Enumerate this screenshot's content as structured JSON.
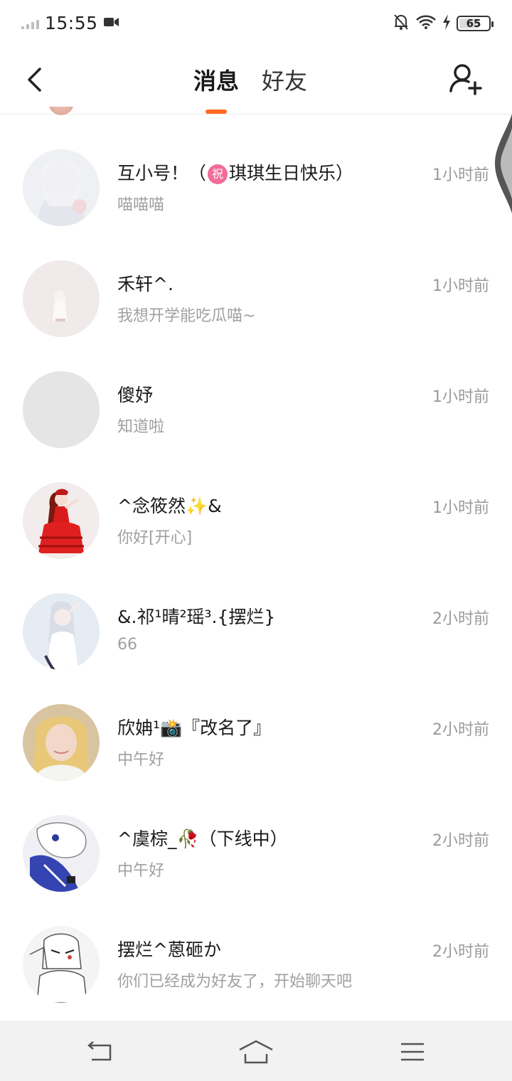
{
  "status_bar": {
    "time": "15:55",
    "battery_level": "65",
    "icons": [
      "signal-icon",
      "video-icon",
      "mute-icon",
      "wifi-icon",
      "charging-icon",
      "battery-icon"
    ]
  },
  "header": {
    "tabs": [
      {
        "label": "消息",
        "active": true
      },
      {
        "label": "好友",
        "active": false
      }
    ],
    "accent_color": "#ff6a1f"
  },
  "conversations": [
    {
      "name_pre": "互小号！（",
      "badge": "祝",
      "name_post": "琪琪生日快乐）",
      "preview": "喵喵喵",
      "time": "1小时前"
    },
    {
      "name_pre": "禾轩^.",
      "preview": "我想开学能吃瓜喵~",
      "time": "1小时前"
    },
    {
      "name_pre": "傻妤",
      "preview": "知道啦",
      "time": "1小时前"
    },
    {
      "name_pre": "^念筱然",
      "sparkle": "✨",
      "name_post": "&",
      "preview": "你好[开心]",
      "time": "1小时前"
    },
    {
      "name_pre": "&.祁¹晴²瑶³.{摆烂}",
      "preview": "66",
      "time": "2小时前"
    },
    {
      "name_pre": "欣姌¹",
      "camera": "📸",
      "name_post": "『改名了』",
      "preview": "中午好",
      "time": "2小时前"
    },
    {
      "name_pre": "^虞棕_",
      "rose": "🥀",
      "name_post": "（下线中）",
      "preview": "中午好",
      "time": "2小时前"
    },
    {
      "name_pre": "摆烂^蒽砸か",
      "preview": "你们已经成为好友了，开始聊天吧",
      "time": "2小时前"
    }
  ]
}
